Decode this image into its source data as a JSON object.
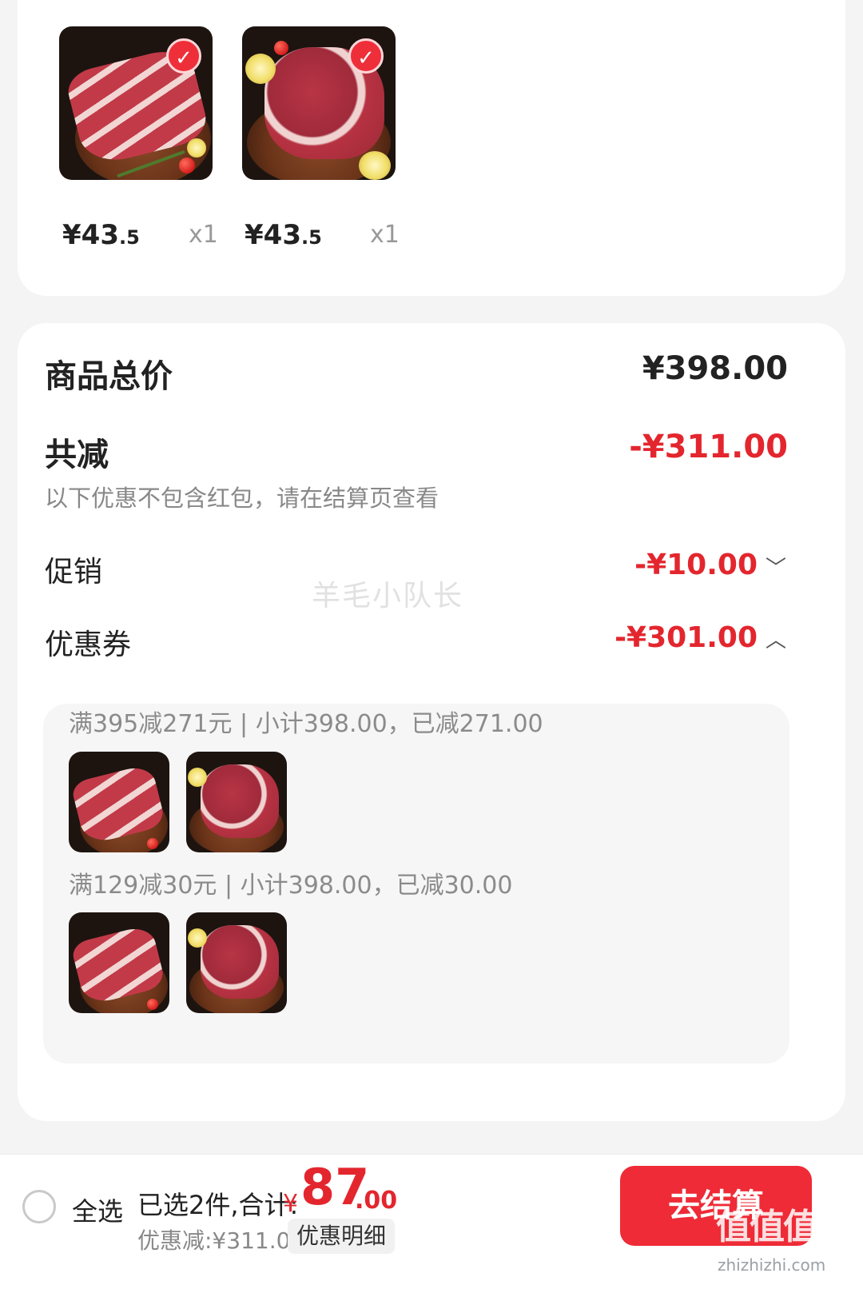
{
  "cart_items": [
    {
      "price_int": "¥43",
      "price_dec": ".5",
      "qty": "x1",
      "checked": true
    },
    {
      "price_int": "¥43",
      "price_dec": ".5",
      "qty": "x1",
      "checked": true
    }
  ],
  "summary": {
    "total_label": "商品总价",
    "total_value": "¥398.00",
    "reduce_label": "共减",
    "reduce_value": "-¥311.00",
    "reduce_note": "以下优惠不包含红包，请在结算页查看",
    "promo_label": "促销",
    "promo_value": "-¥10.00",
    "coupon_label": "优惠券",
    "coupon_value": "-¥301.00"
  },
  "coupons": [
    {
      "text": "满395减271元 | 小计398.00，已减271.00"
    },
    {
      "text": "满129减30元 | 小计398.00，已减30.00"
    }
  ],
  "watermark": "羊毛小队长",
  "bottom": {
    "select_all": "全选",
    "selected_total": "已选2件,合计:",
    "currency": "¥",
    "total_int": "87",
    "total_dec": ".00",
    "discount": "优惠减:¥311.00",
    "detail_btn": "优惠明细",
    "checkout_btn": "去结算",
    "logo": "值值值",
    "logo_site": "zhizhizhi.com"
  },
  "colors": {
    "accent": "#ee2b36",
    "discount_red": "#e3262e",
    "muted": "#888888"
  },
  "icons": [
    "check-icon",
    "chevron-down-icon",
    "chevron-up-icon",
    "radio-icon"
  ]
}
